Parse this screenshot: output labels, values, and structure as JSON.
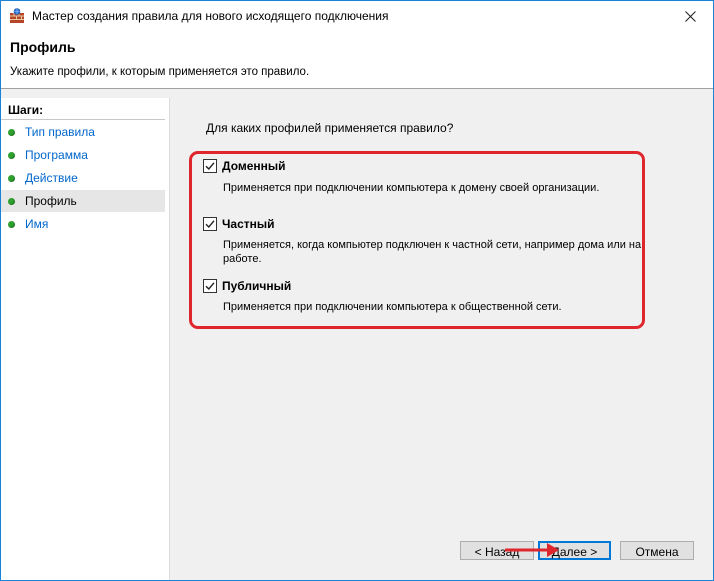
{
  "window": {
    "title": "Мастер создания правила для нового исходящего подключения"
  },
  "header": {
    "title": "Профиль",
    "subtitle": "Укажите профили, к которым применяется это правило."
  },
  "steps": {
    "title": "Шаги:",
    "items": [
      {
        "label": "Тип правила",
        "current": false
      },
      {
        "label": "Программа",
        "current": false
      },
      {
        "label": "Действие",
        "current": false
      },
      {
        "label": "Профиль",
        "current": true
      },
      {
        "label": "Имя",
        "current": false
      }
    ]
  },
  "main": {
    "question": "Для каких профилей применяется правило?",
    "profiles": [
      {
        "label": "Доменный",
        "checked": true,
        "description": "Применяется при подключении компьютера к домену своей организации."
      },
      {
        "label": "Частный",
        "checked": true,
        "description": "Применяется, когда компьютер подключен к частной сети, например дома или на работе."
      },
      {
        "label": "Публичный",
        "checked": true,
        "description": "Применяется при подключении компьютера к общественной сети."
      }
    ]
  },
  "buttons": {
    "back": "< Назад",
    "next": "Далее >",
    "cancel": "Отмена"
  },
  "colors": {
    "highlight": "#e0262d",
    "step_dot": "#2ea12e",
    "link": "#0066cc",
    "accent": "#0078d7"
  },
  "icons": {
    "app": "firewall-icon",
    "close": "close-icon",
    "step": "green-dot-icon",
    "checkbox": "checkmark-icon",
    "pointer": "red-arrow-icon"
  }
}
